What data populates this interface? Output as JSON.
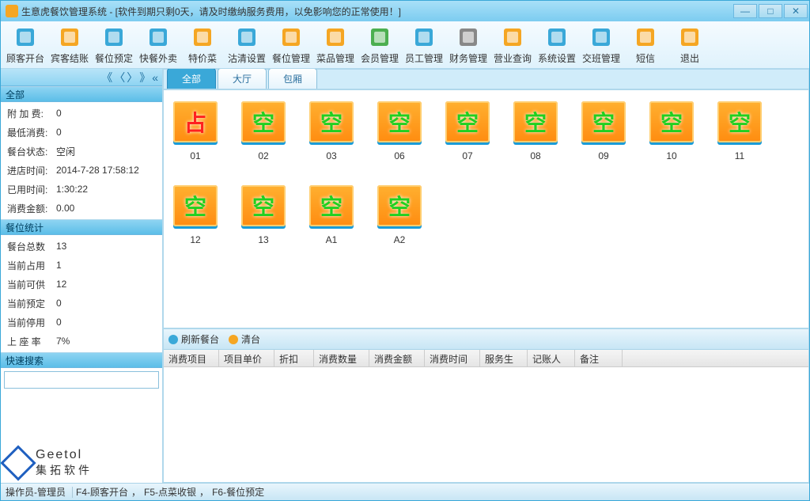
{
  "window": {
    "title": "生意虎餐饮管理系统 - [软件到期只剩0天，请及时缴纳服务费用，以免影响您的正常使用！]"
  },
  "toolbar": [
    {
      "label": "顾客开台",
      "name": "customer-open"
    },
    {
      "label": "宾客结账",
      "name": "guest-checkout"
    },
    {
      "label": "餐位预定",
      "name": "reservation"
    },
    {
      "label": "快餐外卖",
      "name": "fastfood-takeout"
    },
    {
      "label": "特价菜",
      "name": "special-dish"
    },
    {
      "label": "沽清设置",
      "name": "soldout-setting"
    },
    {
      "label": "餐位管理",
      "name": "seat-manage"
    },
    {
      "label": "菜品管理",
      "name": "dish-manage"
    },
    {
      "label": "会员管理",
      "name": "member-manage"
    },
    {
      "label": "员工管理",
      "name": "staff-manage"
    },
    {
      "label": "财务管理",
      "name": "finance-manage"
    },
    {
      "label": "营业查询",
      "name": "business-query"
    },
    {
      "label": "系统设置",
      "name": "system-settings"
    },
    {
      "label": "交班管理",
      "name": "shift-manage"
    },
    {
      "label": "短信",
      "name": "sms"
    },
    {
      "label": "退出",
      "name": "exit"
    }
  ],
  "sidebar": {
    "all_header": "全部",
    "info": [
      {
        "label": "附 加 费:",
        "value": "0"
      },
      {
        "label": "最低消费:",
        "value": "0"
      },
      {
        "label": "餐台状态:",
        "value": "空闲"
      },
      {
        "label": "进店时间:",
        "value": "2014-7-28 17:58:12"
      },
      {
        "label": "已用时间:",
        "value": "1:30:22"
      },
      {
        "label": "消费金额:",
        "value": "0.00"
      }
    ],
    "stats_header": "餐位统计",
    "stats": [
      {
        "label": "餐台总数",
        "value": "13"
      },
      {
        "label": "当前占用",
        "value": "1"
      },
      {
        "label": "当前可供",
        "value": "12"
      },
      {
        "label": "当前预定",
        "value": "0"
      },
      {
        "label": "当前停用",
        "value": "0"
      },
      {
        "label": "上 座 率",
        "value": "7%"
      }
    ],
    "search_header": "快速搜索",
    "logo_en": "Geetol",
    "logo_cn": "集拓软件"
  },
  "tabs": [
    {
      "label": "全部",
      "active": true
    },
    {
      "label": "大厅",
      "active": false
    },
    {
      "label": "包厢",
      "active": false
    }
  ],
  "tables": [
    {
      "id": "01",
      "state": "占",
      "occupied": true
    },
    {
      "id": "02",
      "state": "空",
      "occupied": false
    },
    {
      "id": "03",
      "state": "空",
      "occupied": false
    },
    {
      "id": "06",
      "state": "空",
      "occupied": false
    },
    {
      "id": "07",
      "state": "空",
      "occupied": false
    },
    {
      "id": "08",
      "state": "空",
      "occupied": false
    },
    {
      "id": "09",
      "state": "空",
      "occupied": false
    },
    {
      "id": "10",
      "state": "空",
      "occupied": false
    },
    {
      "id": "11",
      "state": "空",
      "occupied": false
    },
    {
      "id": "12",
      "state": "空",
      "occupied": false
    },
    {
      "id": "13",
      "state": "空",
      "occupied": false
    },
    {
      "id": "A1",
      "state": "空",
      "occupied": false
    },
    {
      "id": "A2",
      "state": "空",
      "occupied": false
    }
  ],
  "actions": {
    "refresh": "刷新餐台",
    "clear": "清台"
  },
  "grid_headers": [
    "消费项目",
    "项目单价",
    "折扣",
    "消费数量",
    "消费金额",
    "消费时间",
    "服务生",
    "记账人",
    "备注"
  ],
  "statusbar": {
    "operator": "操作员-管理员",
    "f4": "F4-顾客开台",
    "f5": "F5-点菜收银",
    "f6": "F6-餐位预定"
  }
}
